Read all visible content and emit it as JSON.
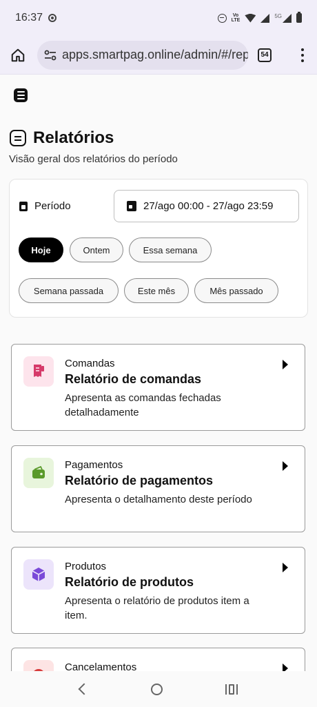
{
  "status_bar": {
    "time": "16:37",
    "network_label": "LTE",
    "network_label_top": "Vo",
    "signal_5g": "5G"
  },
  "browser": {
    "url": "apps.smartpag.online/admin/#/rep",
    "tabs_count": "54"
  },
  "page": {
    "title": "Relatórios",
    "subtitle": "Visão geral dos relatórios do período"
  },
  "period": {
    "label": "Período",
    "range": "27/ago 00:00 - 27/ago 23:59",
    "chips": [
      {
        "label": "Hoje",
        "active": true
      },
      {
        "label": "Ontem",
        "active": false
      },
      {
        "label": "Essa semana",
        "active": false
      },
      {
        "label": "Semana passada",
        "active": false
      },
      {
        "label": "Este mês",
        "active": false
      },
      {
        "label": "Mês passado",
        "active": false
      }
    ]
  },
  "reports": [
    {
      "category": "Comandas",
      "title": "Relatório de comandas",
      "description": "Apresenta as comandas fechadas detalhadamente",
      "icon": "receipt-icon",
      "icon_color": "#d63a6a",
      "icon_bg": "#fde4ec"
    },
    {
      "category": "Pagamentos",
      "title": "Relatório de pagamentos",
      "description": "Apresenta o detalhamento deste período",
      "icon": "wallet-icon",
      "icon_color": "#5a9a2a",
      "icon_bg": "#e8f5dc"
    },
    {
      "category": "Produtos",
      "title": "Relatório de produtos",
      "description": "Apresenta o relatório de produtos item a item.",
      "icon": "box-icon",
      "icon_color": "#7a4ad8",
      "icon_bg": "#ece4fb"
    },
    {
      "category": "Cancelamentos",
      "title": "",
      "description": "",
      "icon": "cancel-icon",
      "icon_color": "#d63a3a",
      "icon_bg": "#fde4e4"
    }
  ]
}
